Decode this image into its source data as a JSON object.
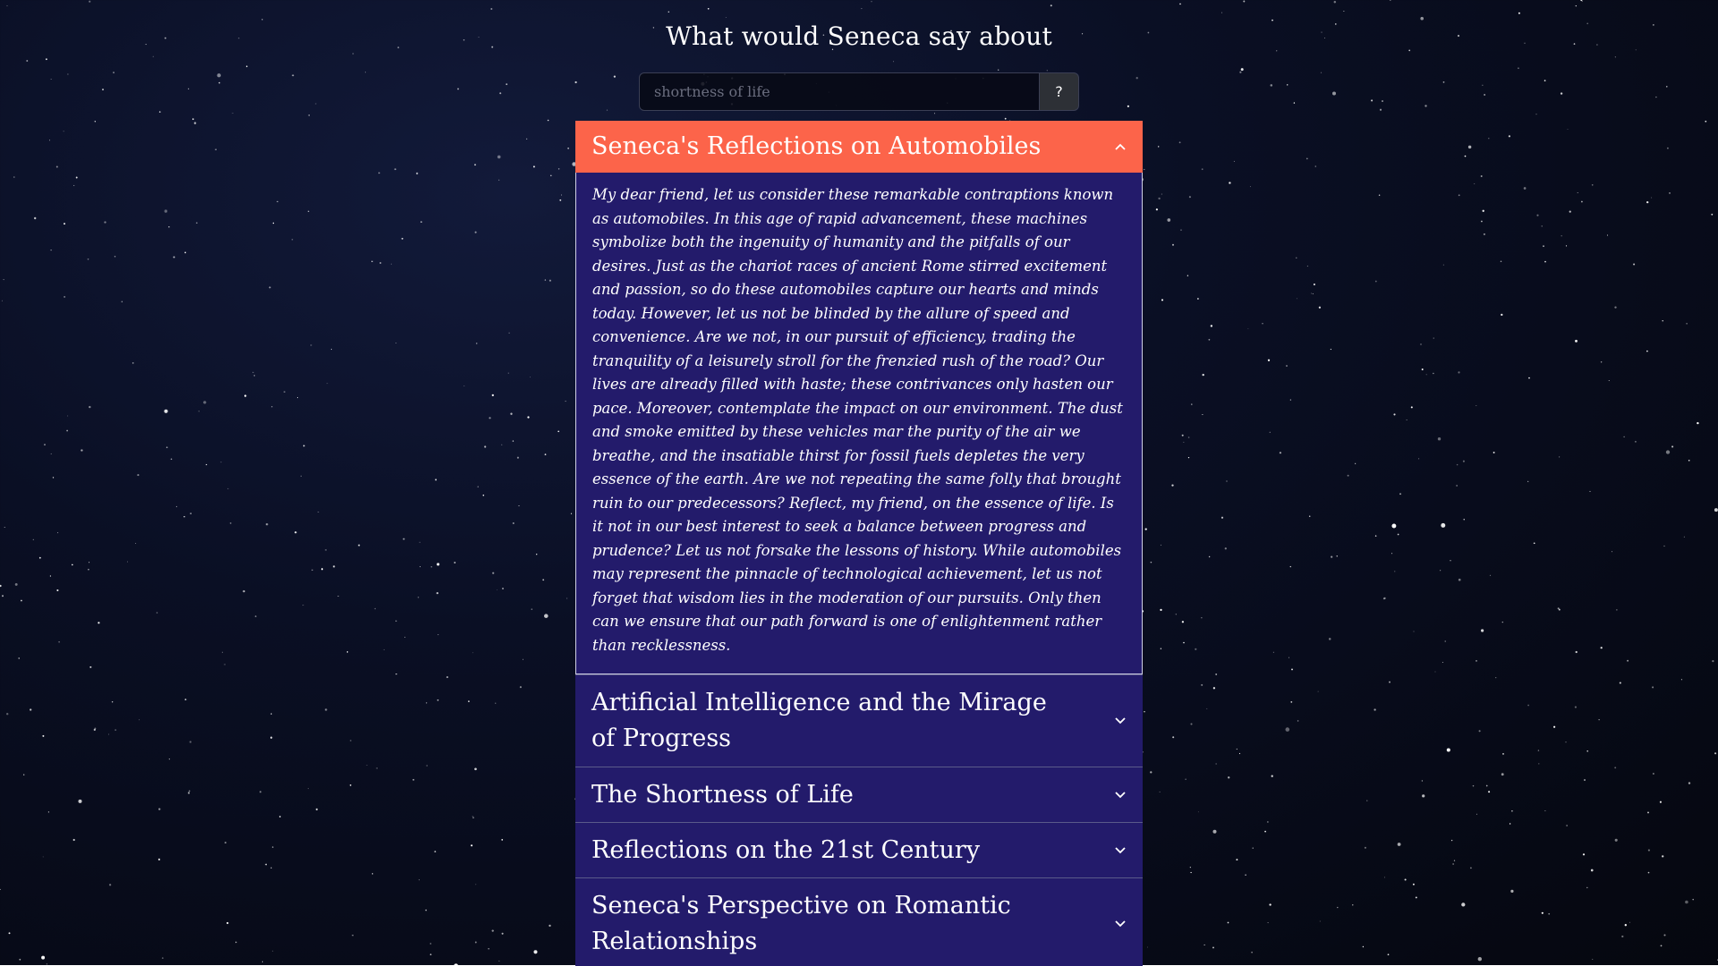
{
  "heading": "What would Seneca say about",
  "search": {
    "placeholder": "shortness of life",
    "button_label": "?"
  },
  "accordion": {
    "items": [
      {
        "title": "Seneca's Reflections on Automobiles",
        "expanded": true,
        "body": "My dear friend, let us consider these remarkable contraptions known as automobiles. In this age of rapid advancement, these machines symbolize both the ingenuity of humanity and the pitfalls of our desires. Just as the chariot races of ancient Rome stirred excitement and passion, so do these automobiles capture our hearts and minds today. However, let us not be blinded by the allure of speed and convenience. Are we not, in our pursuit of efficiency, trading the tranquility of a leisurely stroll for the frenzied rush of the road? Our lives are already filled with haste; these contrivances only hasten our pace. Moreover, contemplate the impact on our environment. The dust and smoke emitted by these vehicles mar the purity of the air we breathe, and the insatiable thirst for fossil fuels depletes the very essence of the earth. Are we not repeating the same folly that brought ruin to our predecessors? Reflect, my friend, on the essence of life. Is it not in our best interest to seek a balance between progress and prudence? Let us not forsake the lessons of history. While automobiles may represent the pinnacle of technological achievement, let us not forget that wisdom lies in the moderation of our pursuits. Only then can we ensure that our path forward is one of enlightenment rather than recklessness."
      },
      {
        "title": "Artificial Intelligence and the Mirage of Progress",
        "expanded": false
      },
      {
        "title": "The Shortness of Life",
        "expanded": false
      },
      {
        "title": "Reflections on the 21st Century",
        "expanded": false
      },
      {
        "title": "Seneca's Perspective on Romantic Relationships",
        "expanded": false
      }
    ]
  },
  "colors": {
    "active_header": "#fc644a",
    "panel": "#231b6b",
    "background": "#05070f"
  },
  "icons": {
    "expanded": "chevron-up-icon",
    "collapsed": "chevron-down-icon"
  }
}
